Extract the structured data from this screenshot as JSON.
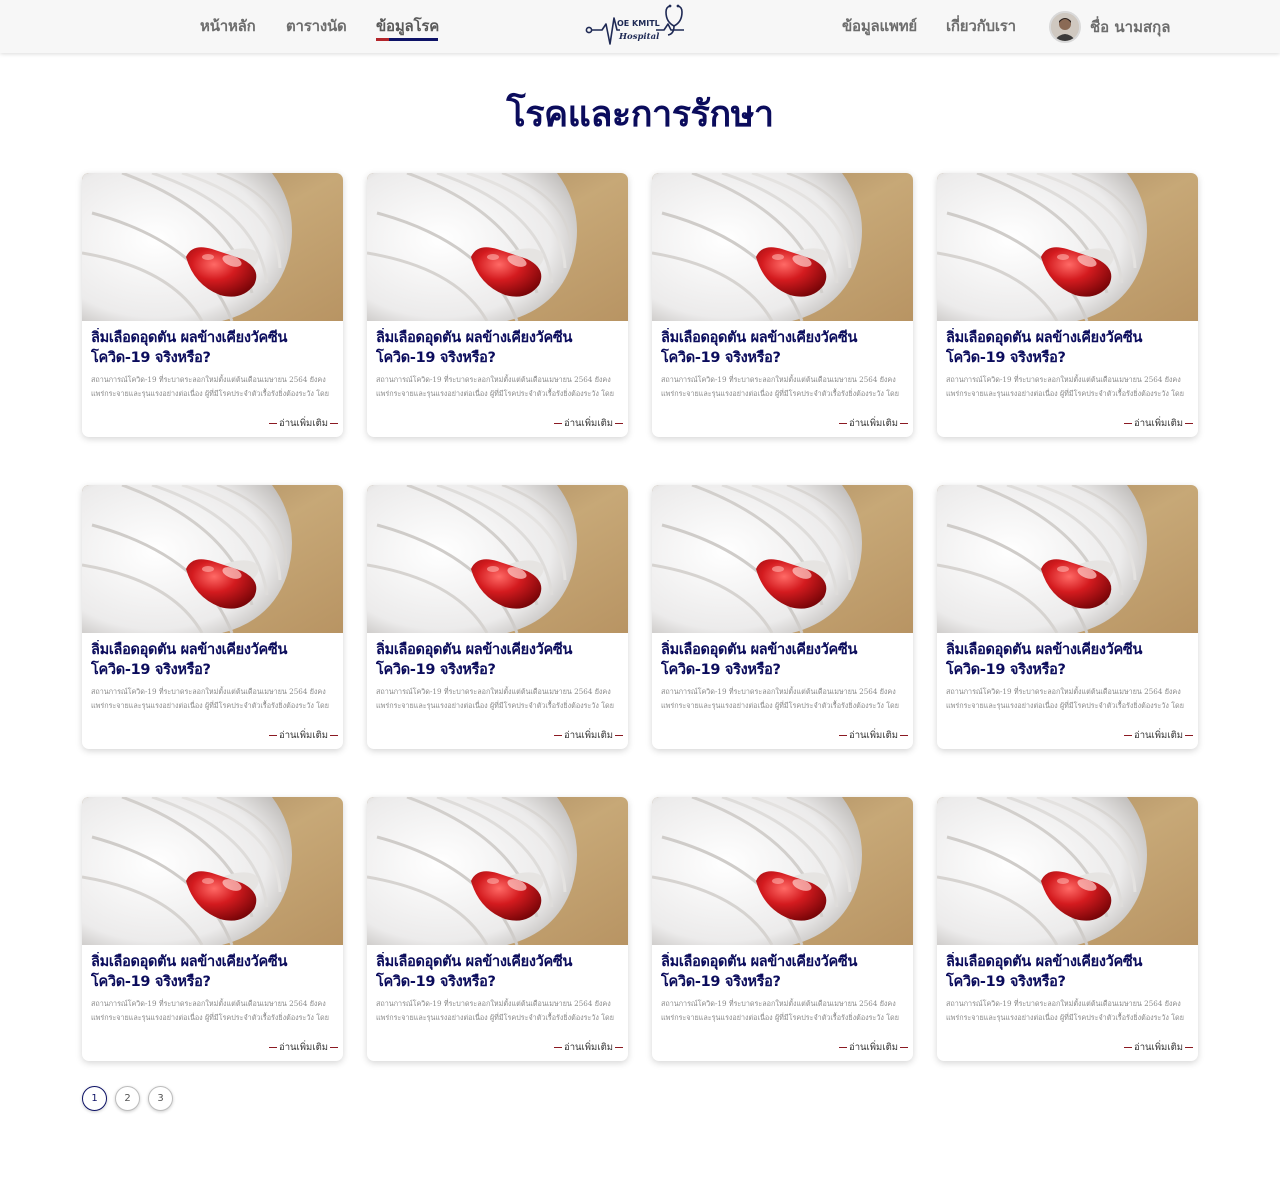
{
  "header": {
    "nav_left": [
      {
        "label": "หน้าหลัก",
        "active": false
      },
      {
        "label": "ตารางนัด",
        "active": false
      },
      {
        "label": "ข้อมูลโรค",
        "active": true
      }
    ],
    "logo": {
      "line1": "OE KMITL",
      "line2": "Hospital"
    },
    "nav_right": [
      {
        "label": "ข้อมูลแพทย์"
      },
      {
        "label": "เกี่ยวกับเรา"
      }
    ],
    "profile_name": "ชื่อ นามสกุล"
  },
  "page_title": "โรคและการรักษา",
  "cards": [
    {
      "title_1": "ลิ่มเลือดอุดตัน ผลข้างเคียงวัคซีน",
      "title_2": "โควิด-19 จริงหรือ?",
      "excerpt_1": "สถานการณ์โควิด-19 ที่ระบาดระลอกใหม่ตั้งแต่ต้นเดือนเมษายน 2564 ยังคง",
      "excerpt_2": "แพร่กระจายและรุนแรงอย่างต่อเนื่อง ผู้ที่มีโรคประจำตัวเรื้อรังยิ่งต้องระวัง โดย",
      "read_more": "อ่านเพิ่มเติม"
    },
    {
      "title_1": "ลิ่มเลือดอุดตัน ผลข้างเคียงวัคซีน",
      "title_2": "โควิด-19 จริงหรือ?",
      "excerpt_1": "สถานการณ์โควิด-19 ที่ระบาดระลอกใหม่ตั้งแต่ต้นเดือนเมษายน 2564 ยังคง",
      "excerpt_2": "แพร่กระจายและรุนแรงอย่างต่อเนื่อง ผู้ที่มีโรคประจำตัวเรื้อรังยิ่งต้องระวัง โดย",
      "read_more": "อ่านเพิ่มเติม"
    },
    {
      "title_1": "ลิ่มเลือดอุดตัน ผลข้างเคียงวัคซีน",
      "title_2": "โควิด-19 จริงหรือ?",
      "excerpt_1": "สถานการณ์โควิด-19 ที่ระบาดระลอกใหม่ตั้งแต่ต้นเดือนเมษายน 2564 ยังคง",
      "excerpt_2": "แพร่กระจายและรุนแรงอย่างต่อเนื่อง ผู้ที่มีโรคประจำตัวเรื้อรังยิ่งต้องระวัง โดย",
      "read_more": "อ่านเพิ่มเติม"
    },
    {
      "title_1": "ลิ่มเลือดอุดตัน ผลข้างเคียงวัคซีน",
      "title_2": "โควิด-19 จริงหรือ?",
      "excerpt_1": "สถานการณ์โควิด-19 ที่ระบาดระลอกใหม่ตั้งแต่ต้นเดือนเมษายน 2564 ยังคง",
      "excerpt_2": "แพร่กระจายและรุนแรงอย่างต่อเนื่อง ผู้ที่มีโรคประจำตัวเรื้อรังยิ่งต้องระวัง โดย",
      "read_more": "อ่านเพิ่มเติม"
    },
    {
      "title_1": "ลิ่มเลือดอุดตัน ผลข้างเคียงวัคซีน",
      "title_2": "โควิด-19 จริงหรือ?",
      "excerpt_1": "สถานการณ์โควิด-19 ที่ระบาดระลอกใหม่ตั้งแต่ต้นเดือนเมษายน 2564 ยังคง",
      "excerpt_2": "แพร่กระจายและรุนแรงอย่างต่อเนื่อง ผู้ที่มีโรคประจำตัวเรื้อรังยิ่งต้องระวัง โดย",
      "read_more": "อ่านเพิ่มเติม"
    },
    {
      "title_1": "ลิ่มเลือดอุดตัน ผลข้างเคียงวัคซีน",
      "title_2": "โควิด-19 จริงหรือ?",
      "excerpt_1": "สถานการณ์โควิด-19 ที่ระบาดระลอกใหม่ตั้งแต่ต้นเดือนเมษายน 2564 ยังคง",
      "excerpt_2": "แพร่กระจายและรุนแรงอย่างต่อเนื่อง ผู้ที่มีโรคประจำตัวเรื้อรังยิ่งต้องระวัง โดย",
      "read_more": "อ่านเพิ่มเติม"
    },
    {
      "title_1": "ลิ่มเลือดอุดตัน ผลข้างเคียงวัคซีน",
      "title_2": "โควิด-19 จริงหรือ?",
      "excerpt_1": "สถานการณ์โควิด-19 ที่ระบาดระลอกใหม่ตั้งแต่ต้นเดือนเมษายน 2564 ยังคง",
      "excerpt_2": "แพร่กระจายและรุนแรงอย่างต่อเนื่อง ผู้ที่มีโรคประจำตัวเรื้อรังยิ่งต้องระวัง โดย",
      "read_more": "อ่านเพิ่มเติม"
    },
    {
      "title_1": "ลิ่มเลือดอุดตัน ผลข้างเคียงวัคซีน",
      "title_2": "โควิด-19 จริงหรือ?",
      "excerpt_1": "สถานการณ์โควิด-19 ที่ระบาดระลอกใหม่ตั้งแต่ต้นเดือนเมษายน 2564 ยังคง",
      "excerpt_2": "แพร่กระจายและรุนแรงอย่างต่อเนื่อง ผู้ที่มีโรคประจำตัวเรื้อรังยิ่งต้องระวัง โดย",
      "read_more": "อ่านเพิ่มเติม"
    },
    {
      "title_1": "ลิ่มเลือดอุดตัน ผลข้างเคียงวัคซีน",
      "title_2": "โควิด-19 จริงหรือ?",
      "excerpt_1": "สถานการณ์โควิด-19 ที่ระบาดระลอกใหม่ตั้งแต่ต้นเดือนเมษายน 2564 ยังคง",
      "excerpt_2": "แพร่กระจายและรุนแรงอย่างต่อเนื่อง ผู้ที่มีโรคประจำตัวเรื้อรังยิ่งต้องระวัง โดย",
      "read_more": "อ่านเพิ่มเติม"
    },
    {
      "title_1": "ลิ่มเลือดอุดตัน ผลข้างเคียงวัคซีน",
      "title_2": "โควิด-19 จริงหรือ?",
      "excerpt_1": "สถานการณ์โควิด-19 ที่ระบาดระลอกใหม่ตั้งแต่ต้นเดือนเมษายน 2564 ยังคง",
      "excerpt_2": "แพร่กระจายและรุนแรงอย่างต่อเนื่อง ผู้ที่มีโรคประจำตัวเรื้อรังยิ่งต้องระวัง โดย",
      "read_more": "อ่านเพิ่มเติม"
    },
    {
      "title_1": "ลิ่มเลือดอุดตัน ผลข้างเคียงวัคซีน",
      "title_2": "โควิด-19 จริงหรือ?",
      "excerpt_1": "สถานการณ์โควิด-19 ที่ระบาดระลอกใหม่ตั้งแต่ต้นเดือนเมษายน 2564 ยังคง",
      "excerpt_2": "แพร่กระจายและรุนแรงอย่างต่อเนื่อง ผู้ที่มีโรคประจำตัวเรื้อรังยิ่งต้องระวัง โดย",
      "read_more": "อ่านเพิ่มเติม"
    },
    {
      "title_1": "ลิ่มเลือดอุดตัน ผลข้างเคียงวัคซีน",
      "title_2": "โควิด-19 จริงหรือ?",
      "excerpt_1": "สถานการณ์โควิด-19 ที่ระบาดระลอกใหม่ตั้งแต่ต้นเดือนเมษายน 2564 ยังคง",
      "excerpt_2": "แพร่กระจายและรุนแรงอย่างต่อเนื่อง ผู้ที่มีโรคประจำตัวเรื้อรังยิ่งต้องระวัง โดย",
      "read_more": "อ่านเพิ่มเติม"
    }
  ],
  "pagination": {
    "pages": [
      "1",
      "2",
      "3"
    ],
    "current": "1"
  },
  "colors": {
    "primary": "#0b0c5c",
    "accent": "#b3252b",
    "nav_text": "#6d6d6d"
  },
  "icons": {
    "logo": "heartbeat-stethoscope-icon",
    "avatar": "user-avatar-icon"
  }
}
